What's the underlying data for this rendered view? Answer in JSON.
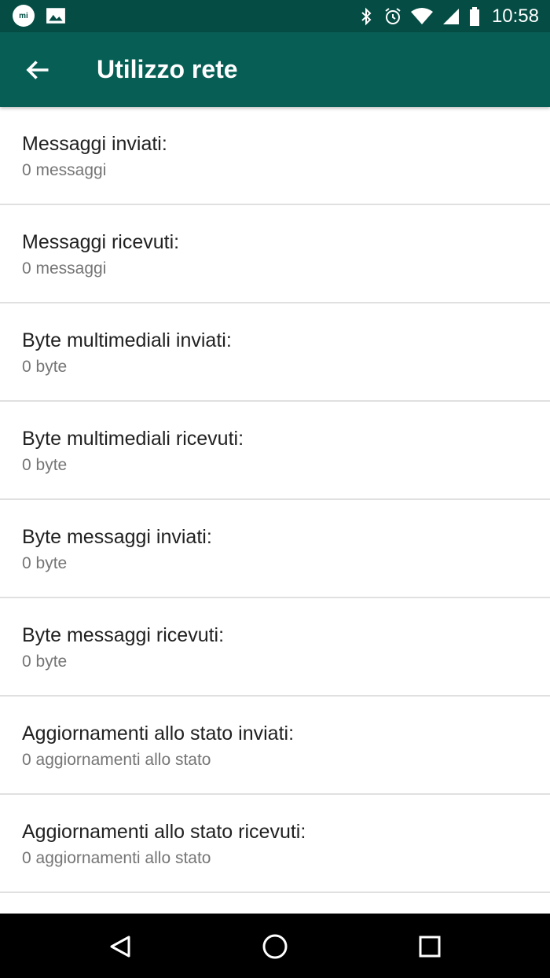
{
  "status_bar": {
    "time": "10:58",
    "left_icons": [
      "mi-icon",
      "gallery-icon"
    ],
    "mi_label": "mi",
    "right_icons": [
      "bluetooth-icon",
      "alarm-icon",
      "wifi-icon",
      "signal-icon",
      "battery-icon"
    ]
  },
  "toolbar": {
    "title": "Utilizzo rete",
    "back_icon": "arrow-back-icon",
    "color": "#075e54",
    "statusbar_color": "#054d44"
  },
  "stats": [
    {
      "label": "Messaggi inviati:",
      "value": "0 messaggi"
    },
    {
      "label": "Messaggi ricevuti:",
      "value": "0 messaggi"
    },
    {
      "label": "Byte multimediali inviati:",
      "value": "0 byte"
    },
    {
      "label": "Byte multimediali ricevuti:",
      "value": "0 byte"
    },
    {
      "label": "Byte messaggi inviati:",
      "value": "0 byte"
    },
    {
      "label": "Byte messaggi ricevuti:",
      "value": "0 byte"
    },
    {
      "label": "Aggiornamenti allo stato inviati:",
      "value": "0 aggiornamenti allo stato"
    },
    {
      "label": "Aggiornamenti allo stato ricevuti:",
      "value": "0 aggiornamenti allo stato"
    }
  ],
  "nav_bar": {
    "buttons": [
      "back-triangle-icon",
      "home-circle-icon",
      "recents-square-icon"
    ]
  }
}
